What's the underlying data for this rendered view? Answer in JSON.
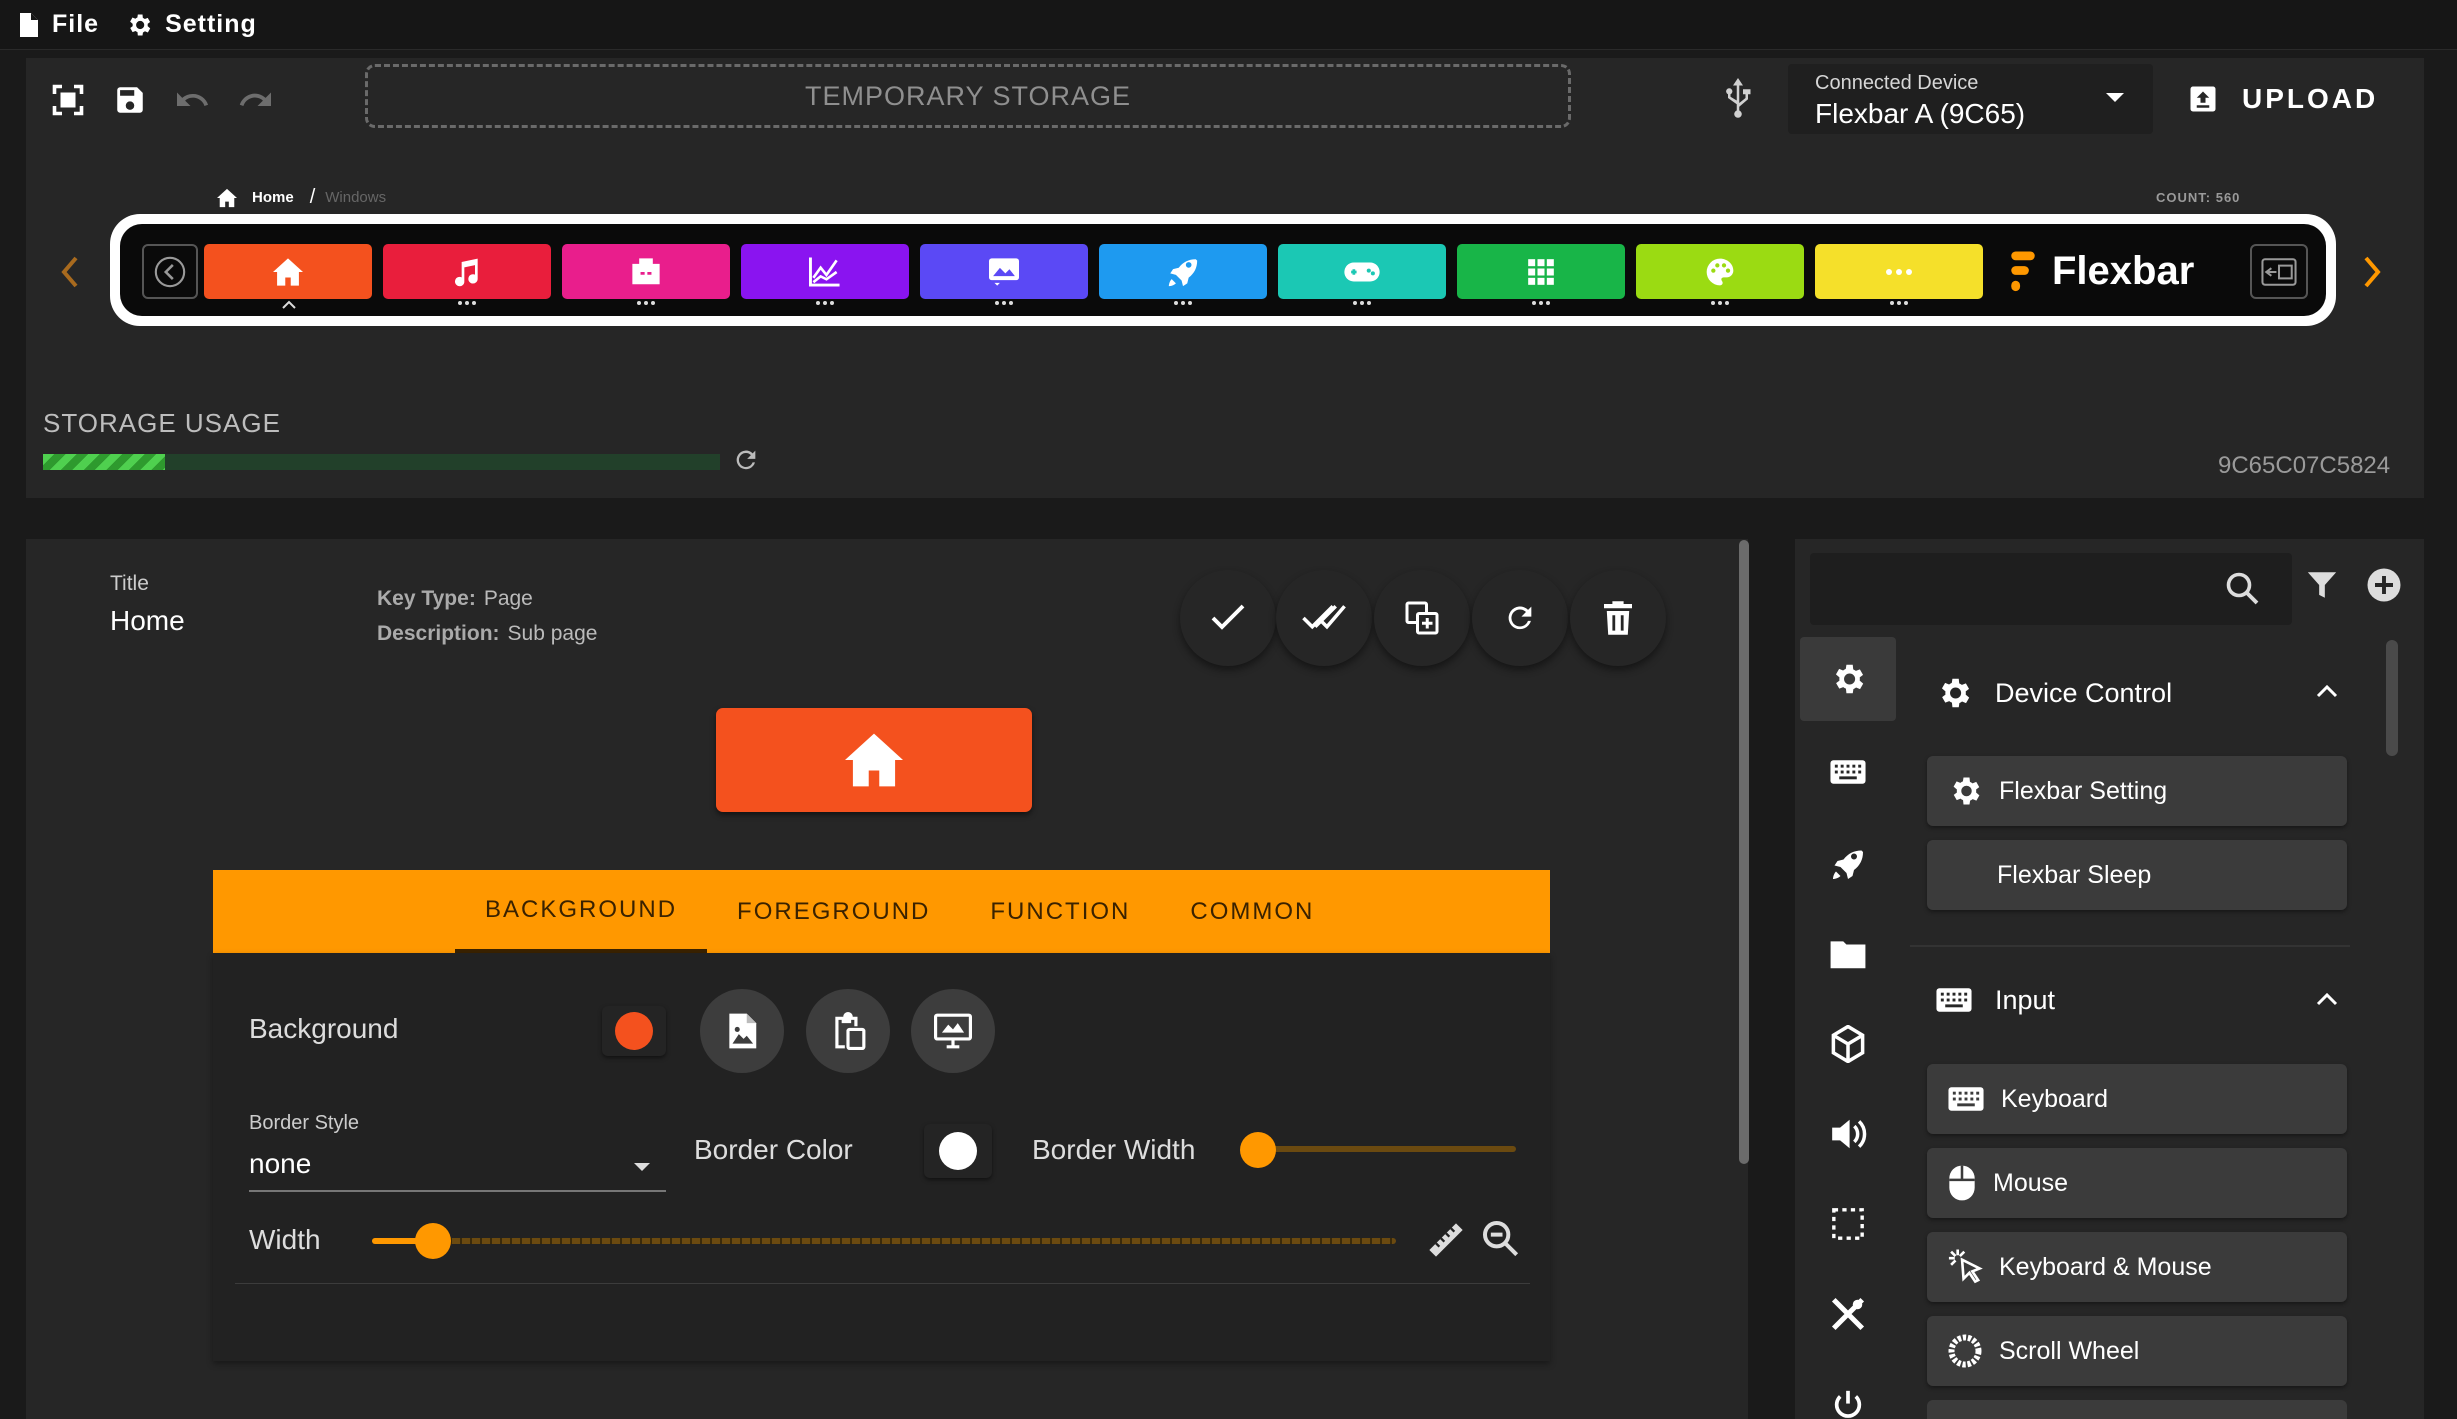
{
  "menu": {
    "file": "File",
    "setting": "Setting"
  },
  "toolbar": {
    "temporary_storage": "TEMPORARY STORAGE",
    "connected_device_label": "Connected Device",
    "connected_device_value": "Flexbar A (9C65)",
    "upload_label": "UPLOAD"
  },
  "breadcrumb": {
    "home": "Home",
    "separator": "/",
    "current": "Windows",
    "count": "COUNT: 560"
  },
  "keystrip": {
    "brand": "Flexbar",
    "keys": [
      {
        "icon": "home-icon",
        "color": "#f4511e"
      },
      {
        "icon": "music-icon",
        "color": "#e91e3c"
      },
      {
        "icon": "briefcase-icon",
        "color": "#e91e8c"
      },
      {
        "icon": "chart-line-icon",
        "color": "#8a14f0"
      },
      {
        "icon": "image-icon",
        "color": "#5b49f5"
      },
      {
        "icon": "rocket-icon",
        "color": "#1e9af0"
      },
      {
        "icon": "gamepad-icon",
        "color": "#1bc8b4"
      },
      {
        "icon": "apps-grid-icon",
        "color": "#18b548"
      },
      {
        "icon": "palette-icon",
        "color": "#9bdb12"
      },
      {
        "icon": "more-icon",
        "color": "#f5e02a"
      }
    ]
  },
  "storage": {
    "label": "STORAGE USAGE",
    "usage_fraction": 0.18,
    "device_id": "9C65C07C5824"
  },
  "editor": {
    "title_label": "Title",
    "title_value": "Home",
    "key_type_label": "Key Type:",
    "key_type_value": "Page",
    "description_label": "Description:",
    "description_value": "Sub page",
    "key_color": "#f4511e",
    "tabs": [
      "BACKGROUND",
      "FOREGROUND",
      "FUNCTION",
      "COMMON"
    ],
    "background_label": "Background",
    "background_color": "#f4511e",
    "border_style_label": "Border Style",
    "border_style_value": "none",
    "border_color_label": "Border Color",
    "border_color_value": "#ffffff",
    "border_width_label": "Border Width",
    "border_width_value": 0,
    "width_label": "Width",
    "width_fraction": 0.06
  },
  "sidebar": {
    "search_placeholder": "",
    "sections": [
      {
        "title": "Device Control",
        "items": [
          "Flexbar Setting",
          "Flexbar Sleep"
        ]
      },
      {
        "title": "Input",
        "items": [
          "Keyboard",
          "Mouse",
          "Keyboard & Mouse",
          "Scroll Wheel"
        ]
      }
    ]
  },
  "colors": {
    "accent": "#ff9800",
    "key_home": "#f4511e"
  }
}
